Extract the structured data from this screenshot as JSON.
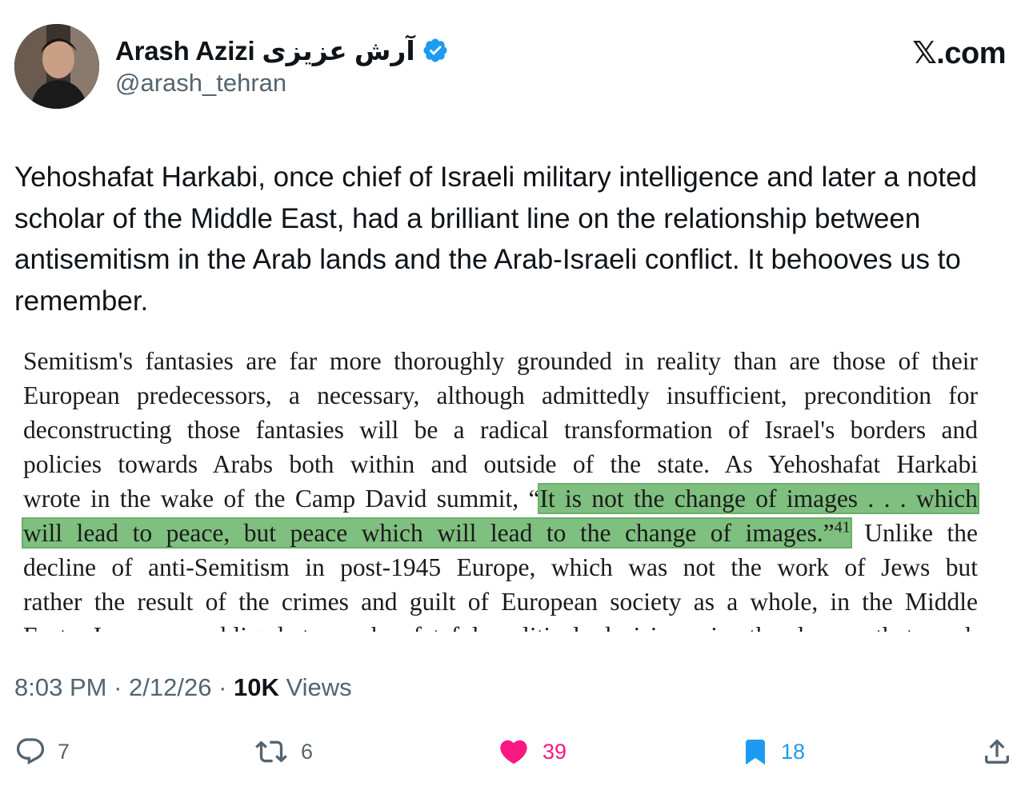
{
  "author": {
    "display_name": "Arash Azizi آرش عزیزی",
    "handle": "@arash_tehran",
    "verified_icon": "verified-badge-icon"
  },
  "brand": "𝕏.com",
  "tweet": {
    "text": "Yehoshafat Harkabi, once chief of Israeli military intelligence and later a noted scholar of the Middle East, had a brilliant line on the relationship between antisemitism in the Arab lands and the Arab-Israeli conflict. It behooves us to remember."
  },
  "excerpt": {
    "line1": "Semitism's fantasies are far more thoroughly grounded in reality than are those of their",
    "line2": "European predecessors, a necessary, although admittedly insufficient, precondition for",
    "line3": "deconstructing those fantasies will be a radical transformation of Israel's borders and",
    "line4": "policies towards Arabs both within and outside of the state. As Yehoshafat Harkabi",
    "line5_pre": "wrote in the wake of the Camp David summit, “",
    "line5_hl": "It is not the change of images . . . which",
    "line6_hl": "will lead to peace, but peace which will lead to the change of images.”",
    "line6_sup": "41",
    "line6_post": " Unlike the",
    "line7": "decline of anti-Semitism in post-1945 Europe, which was not the work of Jews but",
    "line8": "rather the result of the crimes and guilt of European society as a whole, in the Middle",
    "line9": "East, Jews are obliged to make fateful political decisions in the hopes that such",
    "highlight_color": "#7fbf7f"
  },
  "meta": {
    "time": "8:03 PM",
    "sep1": " · ",
    "date": "2/12/26",
    "sep2": " · ",
    "views_count": "10K",
    "views_label": " Views"
  },
  "actions": {
    "replies": "7",
    "reposts": "6",
    "likes": "39",
    "bookmarks": "18",
    "like_color": "#f91880",
    "bookmark_color": "#1d9bf0"
  }
}
